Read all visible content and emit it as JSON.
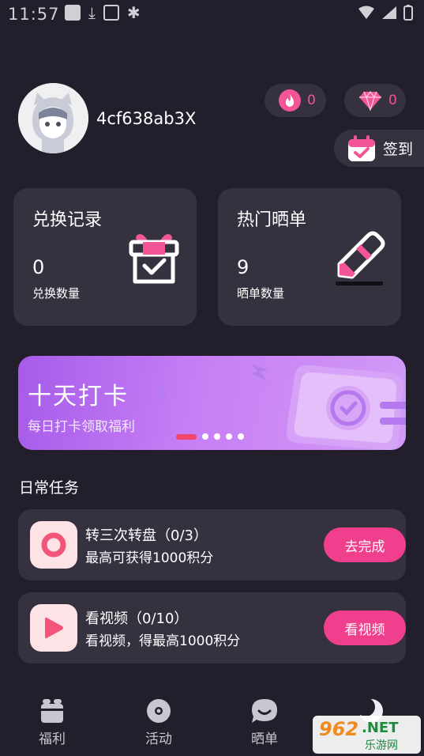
{
  "status_bar": {
    "time": "11:57"
  },
  "profile": {
    "username": "4cf638ab3X"
  },
  "counters": {
    "fire_value": "0",
    "gem_value": "0"
  },
  "signin": {
    "label": "签到"
  },
  "cards": [
    {
      "title": "兑换记录",
      "count": "0",
      "subtitle": "兑换数量",
      "icon": "gift-box-icon"
    },
    {
      "title": "热门晒单",
      "count": "9",
      "subtitle": "晒单数量",
      "icon": "pencil-icon"
    }
  ],
  "banner": {
    "title": "十天打卡",
    "subtitle": "每日打卡领取福利",
    "pages": 5,
    "active_page": 1
  },
  "daily_tasks": {
    "title": "日常任务",
    "items": [
      {
        "name": "转三次转盘（0/3）",
        "desc": "最高可获得1000积分",
        "button": "去完成",
        "icon": "wheel-icon"
      },
      {
        "name": "看视频（0/10）",
        "desc": "看视频，得最高1000积分",
        "button": "看视频",
        "icon": "play-icon"
      }
    ]
  },
  "nav": [
    {
      "label": "福利",
      "icon": "gift-icon"
    },
    {
      "label": "活动",
      "icon": "disc-icon"
    },
    {
      "label": "晒单",
      "icon": "chat-icon"
    },
    {
      "label": "",
      "icon": "moon-icon"
    }
  ],
  "watermark": {
    "brand": "962",
    "net": ".NET",
    "cn": "乐游网"
  },
  "colors": {
    "background": "#221e2c",
    "card": "#36313f",
    "accent": "#f03f8d",
    "banner_start": "#a65bea"
  }
}
